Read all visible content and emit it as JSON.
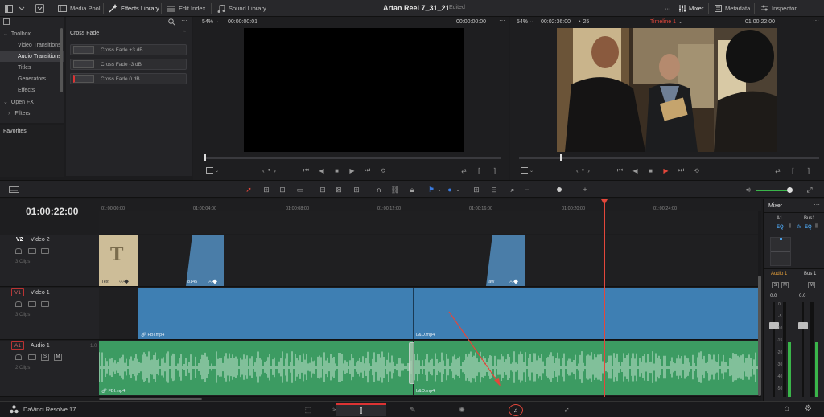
{
  "topbar": {
    "media_pool": "Media Pool",
    "effects_library": "Effects Library",
    "edit_index": "Edit Index",
    "sound_library": "Sound Library",
    "project_title": "Artan Reel 7_31_21",
    "project_status": "Edited",
    "mixer": "Mixer",
    "metadata": "Metadata",
    "inspector": "Inspector"
  },
  "toolbox": {
    "items": [
      "Toolbox",
      "Video Transitions",
      "Audio Transitions",
      "Titles",
      "Generators",
      "Effects",
      "Open FX",
      "Filters"
    ],
    "favorites": "Favorites"
  },
  "effects_list": {
    "header": "Cross Fade",
    "items": [
      "Cross Fade +3 dB",
      "Cross Fade -3 dB",
      "Cross Fade 0 dB"
    ]
  },
  "source_viewer": {
    "zoom": "54%",
    "timecode_left": "00:00:00:01",
    "timecode_right": "00:00:00:00"
  },
  "timeline_viewer": {
    "zoom": "54%",
    "duration": "00:02:36:00",
    "fps": "25",
    "timeline_name": "Timeline 1",
    "timecode": "01:00:22:00"
  },
  "timeline": {
    "timecode": "01:00:22:00",
    "ruler": [
      "01:00:00:00",
      "01:00:04:00",
      "01:00:08:00",
      "01:00:12:00",
      "01:00:16:00",
      "01:00:20:00",
      "01:00:24:00"
    ],
    "tracks": {
      "v2": {
        "id": "V2",
        "name": "Video 2",
        "sub": "3 Clips"
      },
      "v1": {
        "id": "V1",
        "name": "Video 1",
        "sub": "3 Clips"
      },
      "a1": {
        "id": "A1",
        "name": "Audio 1",
        "level": "1.0",
        "sub": "2 Clips"
      }
    },
    "clips": {
      "v2_text": "Text",
      "v2_title_glyph": "T",
      "v2_clip2": "8145",
      "v2_clip3": "law",
      "v1_clip1": "FBI.mp4",
      "v1_clip2": "L&O.mp4",
      "a1_clip1": "FBI.mp4",
      "a1_clip2": "L&O.mp4"
    }
  },
  "mixer": {
    "title": "Mixer",
    "ch1": "A1",
    "ch2": "Bus1",
    "eq": "EQ",
    "fx": "fx",
    "ch1_name": "Audio 1",
    "ch2_name": "Bus 1",
    "s": "S",
    "m": "M",
    "level_val1": "0.0",
    "level_val2": "0.0",
    "scale": [
      "0",
      "-5",
      "-10",
      "-15",
      "-20",
      "-30",
      "-40",
      "-50"
    ]
  },
  "bottombar": {
    "app_name": "DaVinci Resolve 17"
  },
  "colors": {
    "accent_red": "#e3473b",
    "video_clip": "#3e7fb3",
    "audio_clip": "#3c9b62",
    "meter_green": "#3ab54a"
  }
}
